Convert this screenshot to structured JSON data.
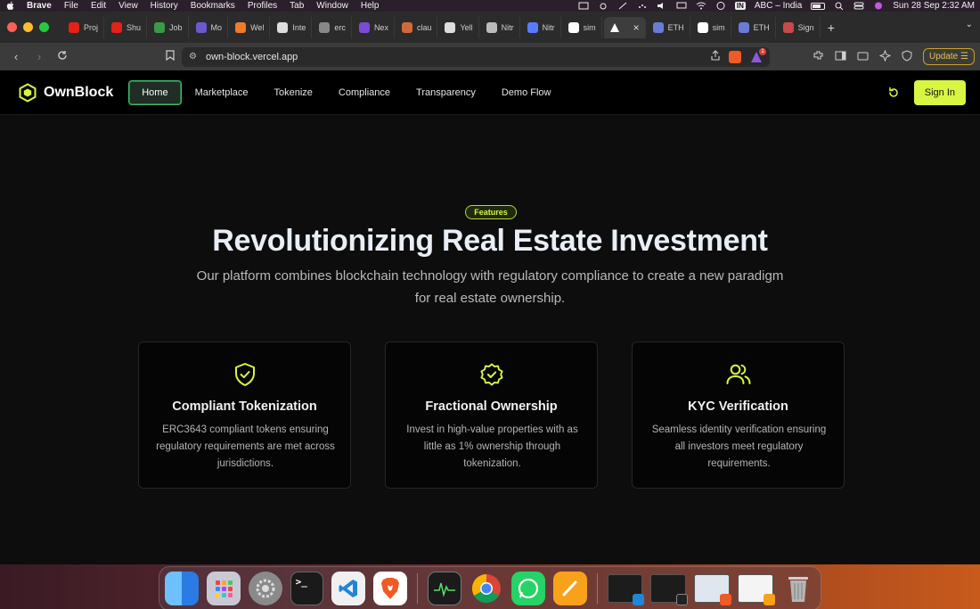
{
  "menubar": {
    "app": "Brave",
    "menus": [
      "File",
      "Edit",
      "View",
      "History",
      "Bookmarks",
      "Profiles",
      "Tab",
      "Window",
      "Help"
    ],
    "input_source": "ABC – India",
    "input_badge": "IN",
    "datetime": "Sun 28 Sep  2:32 AM"
  },
  "tabs": [
    {
      "label": "Proj",
      "color": "#e62117"
    },
    {
      "label": "Shu",
      "color": "#e62117"
    },
    {
      "label": "Job",
      "color": "#3a9a4a"
    },
    {
      "label": "Mo",
      "color": "#6a5acd"
    },
    {
      "label": "Wel",
      "color": "#f07b2a"
    },
    {
      "label": "Inte",
      "color": "#dddddd"
    },
    {
      "label": "erc",
      "color": "#888888"
    },
    {
      "label": "Nex",
      "color": "#7b4bd6"
    },
    {
      "label": "clau",
      "color": "#d2693a"
    },
    {
      "label": "Yell",
      "color": "#dddddd"
    },
    {
      "label": "Nitr",
      "color": "#bbbbbb"
    },
    {
      "label": "Nitr",
      "color": "#5a7bff"
    },
    {
      "label": "sim",
      "color": "#ffffff"
    },
    {
      "label": "",
      "color": "#ffffff",
      "active": true
    },
    {
      "label": "ETH",
      "color": "#6a7bd6"
    },
    {
      "label": "sim",
      "color": "#ffffff"
    },
    {
      "label": "ETH",
      "color": "#6a7bd6"
    },
    {
      "label": "Sign",
      "color": "#c84a4a"
    }
  ],
  "addressbar": {
    "url": "own-block.vercel.app",
    "brave_shield_count": "",
    "notification_count": "1",
    "update_label": "Update"
  },
  "site": {
    "logo_text": "OwnBlock",
    "nav": [
      "Home",
      "Marketplace",
      "Tokenize",
      "Compliance",
      "Transparency",
      "Demo Flow"
    ],
    "active_nav": "Home",
    "signin_label": "Sign In"
  },
  "hero": {
    "badge": "Features",
    "title": "Revolutionizing Real Estate Investment",
    "subtitle": "Our platform combines blockchain technology with regulatory compliance to create a new paradigm for real estate ownership."
  },
  "features": [
    {
      "icon": "shield-check-icon",
      "title": "Compliant Tokenization",
      "description": "ERC3643 compliant tokens ensuring regulatory requirements are met across jurisdictions."
    },
    {
      "icon": "badge-check-icon",
      "title": "Fractional Ownership",
      "description": "Invest in high-value properties with as little as 1% ownership through tokenization."
    },
    {
      "icon": "users-icon",
      "title": "KYC Verification",
      "description": "Seamless identity verification ensuring all investors meet regulatory requirements."
    }
  ],
  "colors": {
    "accent": "#d8f544",
    "active_nav_border": "#3fb86a",
    "background": "#0d0d0d"
  },
  "dock": {
    "apps": [
      "finder-icon",
      "launchpad-icon",
      "system-settings-icon",
      "terminal-icon",
      "vscode-icon",
      "brave-icon",
      "activity-monitor-icon",
      "chrome-icon",
      "whatsapp-icon",
      "pages-icon"
    ],
    "trash": "trash-icon"
  }
}
